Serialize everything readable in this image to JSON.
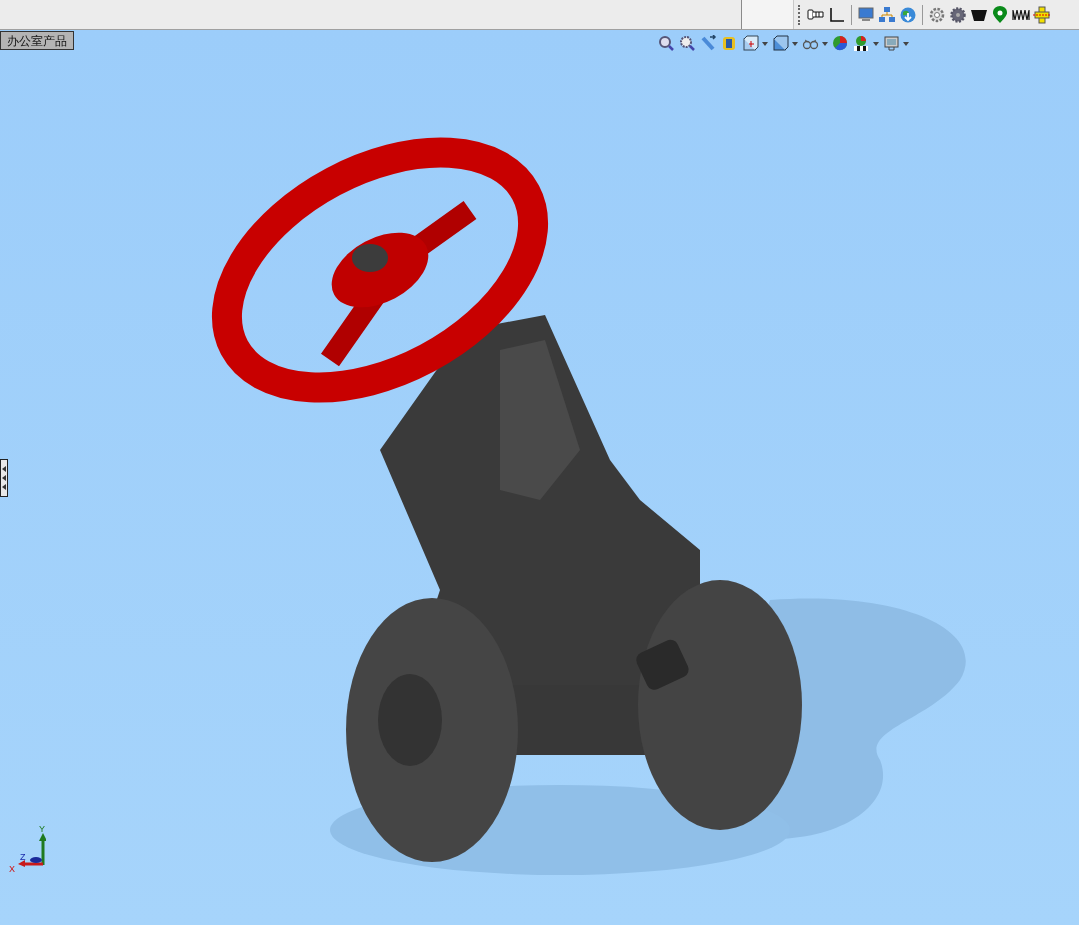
{
  "document_tab": {
    "label": "办公室产品"
  },
  "heads_up_toolbar": [
    {
      "dropdown": false
    },
    {
      "dropdown": false
    },
    {
      "dropdown": false
    },
    {
      "dropdown": false
    },
    {
      "dropdown": true
    },
    {
      "dropdown": true
    },
    {
      "dropdown": true
    },
    {
      "dropdown": false
    },
    {
      "dropdown": true
    },
    {
      "dropdown": true
    }
  ],
  "triad": {
    "x": "X",
    "y": "Y",
    "z": "Z"
  }
}
